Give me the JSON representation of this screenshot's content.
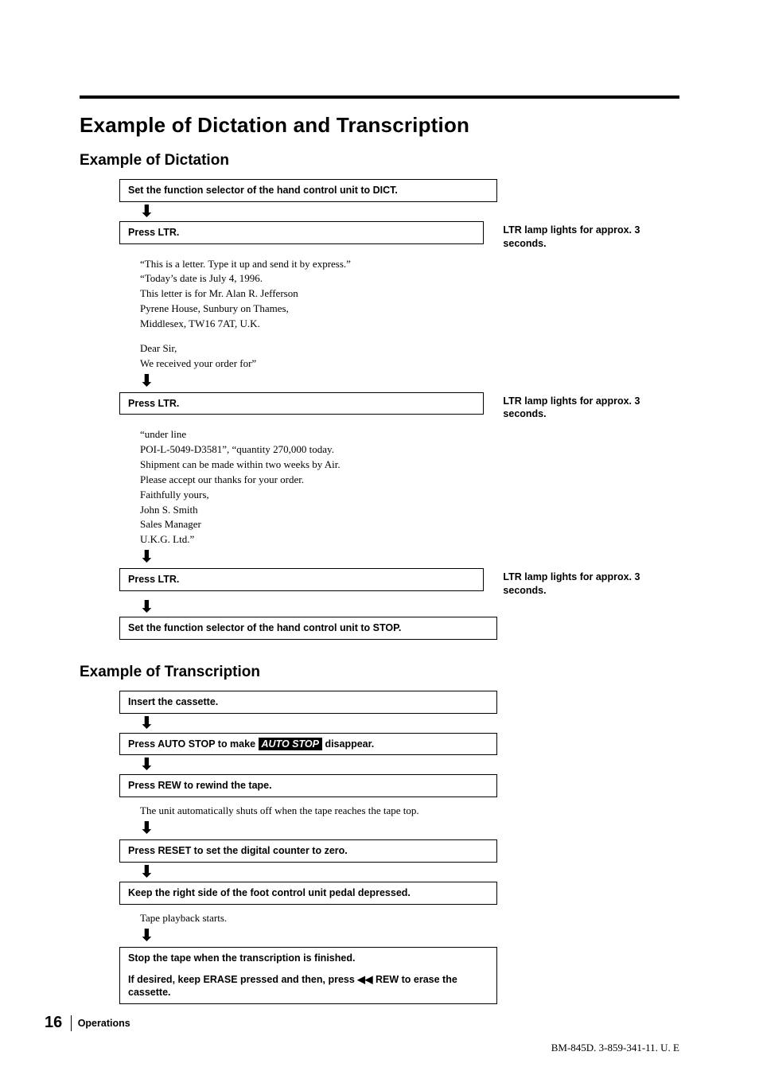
{
  "h1": "Example of Dictation and Transcription",
  "dictation": {
    "h2": "Example of Dictation",
    "step1": "Set the function selector of the hand control unit to DICT.",
    "step2": "Press LTR.",
    "side2": "LTR lamp lights for approx. 3 seconds.",
    "body1_l1": "“This is a letter. Type it up and send it by express.”",
    "body1_l2": "“Today’s date is July 4, 1996.",
    "body1_l3": "This letter is for Mr. Alan R. Jefferson",
    "body1_l4": "Pyrene House, Sunbury on Thames,",
    "body1_l5": "Middlesex, TW16 7AT, U.K.",
    "body1_l6": "Dear Sir,",
    "body1_l7": "We received your order for”",
    "step3": "Press LTR.",
    "side3": "LTR lamp lights for approx. 3 seconds.",
    "body2_l1": "“under line",
    "body2_l2": "POI-L-5049-D3581”, “quantity 270,000 today.",
    "body2_l3": "Shipment can be made within two weeks by Air.",
    "body2_l4": "Please accept our thanks for your order.",
    "body2_l5": "Faithfully yours,",
    "body2_l6": "John S. Smith",
    "body2_l7": "Sales Manager",
    "body2_l8": "U.K.G. Ltd.”",
    "step4": "Press LTR.",
    "side4": "LTR lamp lights for approx. 3 seconds.",
    "step5": "Set the function selector of the hand control unit to STOP."
  },
  "transcription": {
    "h2": "Example of Transcription",
    "step1": "Insert the cassette.",
    "step2_pre": "Press AUTO STOP to make ",
    "step2_inv": "AUTO STOP",
    "step2_post": " disappear.",
    "step3": "Press REW to rewind the tape.",
    "body1": "The unit automatically shuts off when the tape reaches the tape top.",
    "step4": "Press RESET to set the digital counter to zero.",
    "step5": "Keep the right side of the foot control unit pedal depressed.",
    "body2": "Tape playback starts.",
    "step6_l1": "Stop the tape when the transcription is finished.",
    "step6_l2": "If desired, keep ERASE pressed and then, press ◀◀ REW to erase the cassette."
  },
  "footer": {
    "page": "16",
    "section": "Operations",
    "code": "BM-845D. 3-859-341-11. U. E"
  }
}
